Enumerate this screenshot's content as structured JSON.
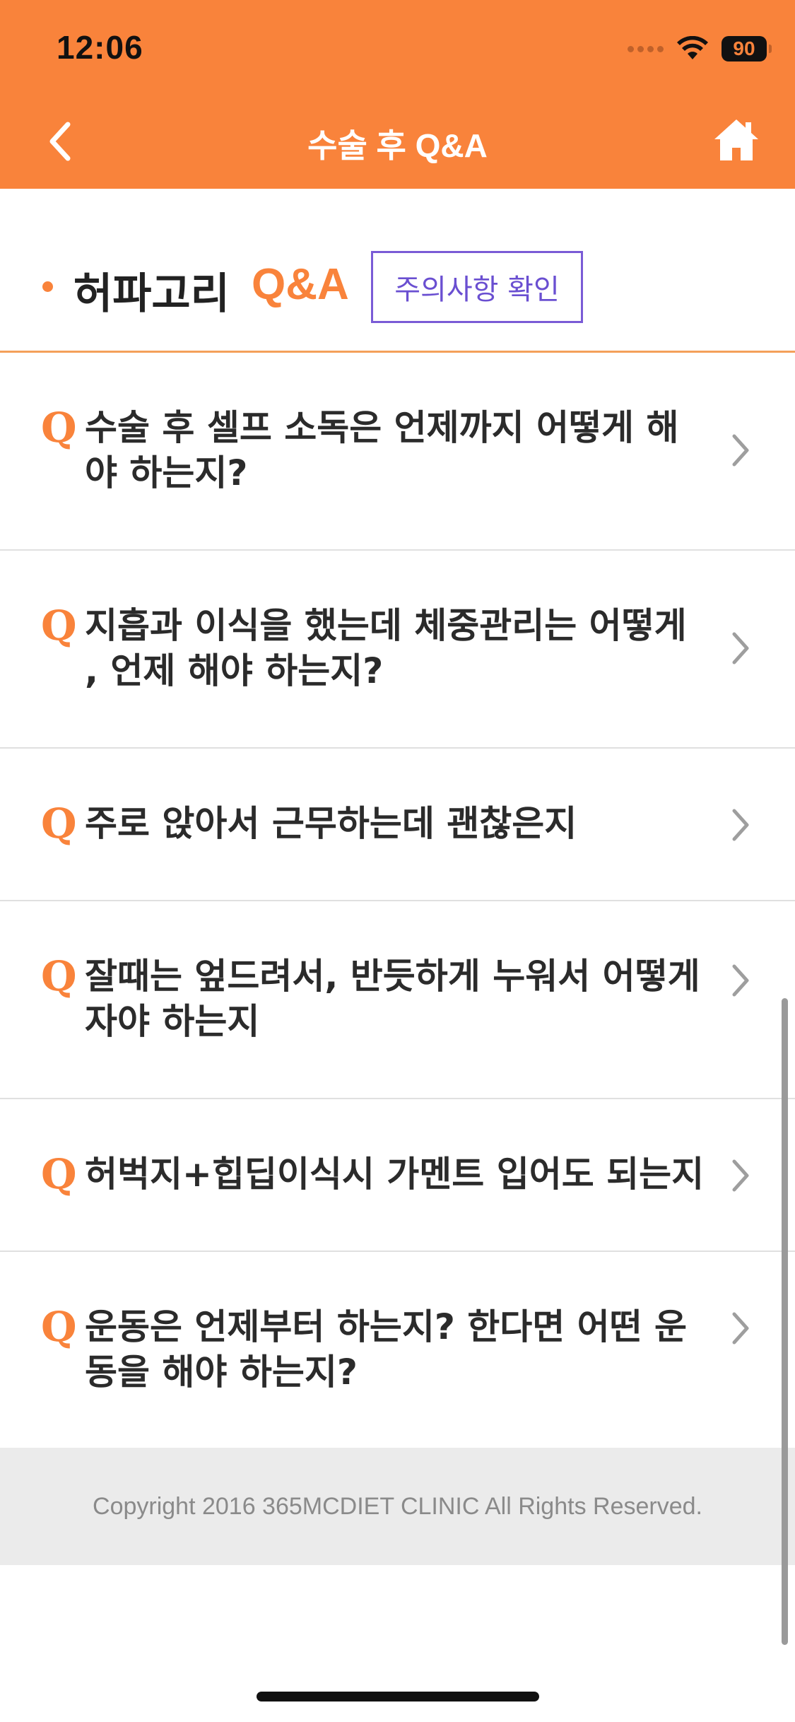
{
  "status_bar": {
    "time": "12:06",
    "battery": "90"
  },
  "nav": {
    "title": "수술 후 Q&A",
    "back_icon": "chevron-left-icon",
    "home_icon": "home-icon"
  },
  "section": {
    "name": "허파고리",
    "qa_label": "Q&A",
    "notice_button": "주의사항 확인"
  },
  "qa_list": [
    {
      "q": "Q",
      "text": "수술 후 셀프 소독은 언제까지 어떻게 해야 하는지?"
    },
    {
      "q": "Q",
      "text": "지흡과 이식을 했는데 체중관리는 어떻게 , 언제 해야 하는지?"
    },
    {
      "q": "Q",
      "text": "주로 앉아서 근무하는데 괜찮은지"
    },
    {
      "q": "Q",
      "text": "잘때는 엎드려서, 반듯하게 누워서 어떻게 자야 하는지"
    },
    {
      "q": "Q",
      "text": "허벅지+힙딥이식시 가멘트 입어도 되는지"
    },
    {
      "q": "Q",
      "text": "운동은 언제부터 하는지? 한다면 어떤 운동을 해야 하는지?"
    }
  ],
  "footer": {
    "copyright": "Copyright 2016 365MCDIET CLINIC All Rights Reserved."
  },
  "colors": {
    "accent": "#F9833B",
    "notice": "#6A4FD1"
  }
}
